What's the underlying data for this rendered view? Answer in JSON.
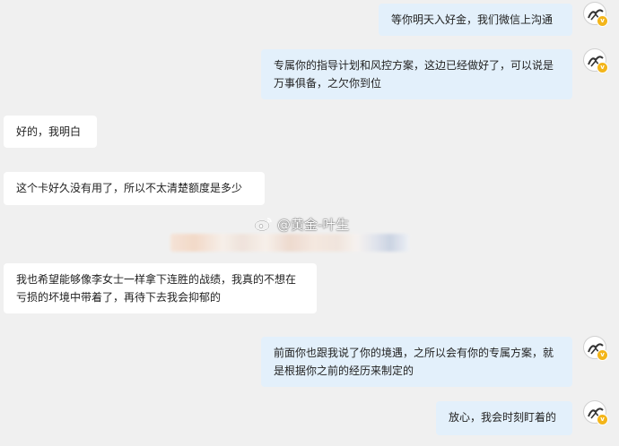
{
  "chat": {
    "messages": [
      {
        "sender": "agent",
        "text": "等你明天入好金，我们微信上沟通"
      },
      {
        "sender": "agent",
        "text": "专属你的指导计划和风控方案，这边已经做好了，可以说是万事俱备，之欠你到位"
      },
      {
        "sender": "user",
        "text": "好的，我明白"
      },
      {
        "sender": "user",
        "text": "这个卡好久没有用了，所以不太清楚额度是多少"
      },
      {
        "sender": "user",
        "text": "我也希望能够像李女士一样拿下连胜的战绩，我真的不想在亏损的坏境中带着了，再待下去我会抑郁的"
      },
      {
        "sender": "agent",
        "text": "前面你也跟我说了你的境遇，之所以会有你的专属方案，就是根据你之前的经历来制定的"
      },
      {
        "sender": "agent",
        "text": "放心，我会时刻盯着的"
      }
    ]
  },
  "watermark": {
    "text": "@黄金-叶生",
    "icon": "weibo-icon"
  },
  "colors": {
    "background": "#f0f0f0",
    "outgoing_bubble": "#e3f0fb",
    "incoming_bubble": "#ffffff",
    "badge": "#f3b51a"
  }
}
